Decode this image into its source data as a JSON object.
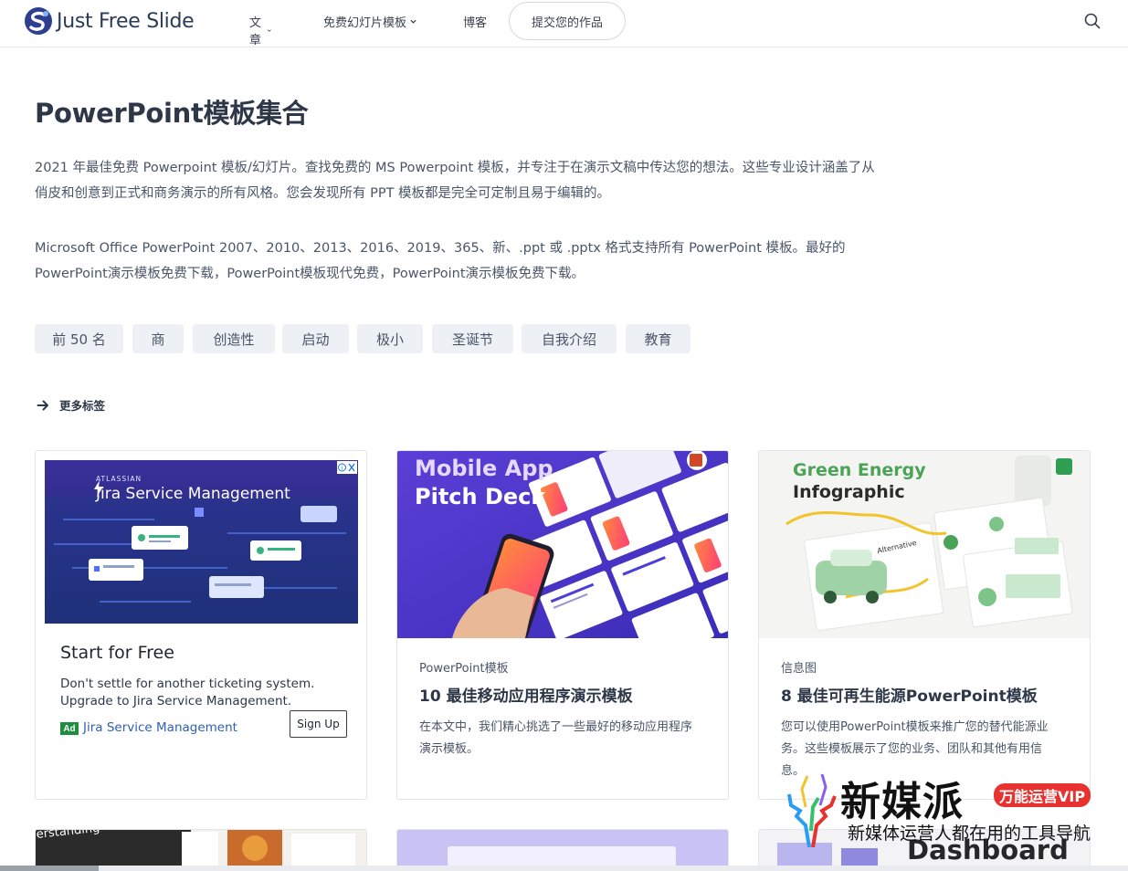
{
  "brand": {
    "logo_text": "Just Free Slide"
  },
  "nav": {
    "items": [
      {
        "label": "文章"
      },
      {
        "label": "免费幻灯片模板"
      },
      {
        "label": "博客"
      }
    ],
    "submit_label": "提交您的作品"
  },
  "page": {
    "title": "PowerPoint模板集合",
    "intro_1": "2021 年最佳免费 Powerpoint 模板/幻灯片。查找免费的 MS Powerpoint 模板，并专注于在演示文稿中传达您的想法。这些专业设计涵盖了从俏皮和创意到正式和商务演示的所有风格。您会发现所有 PPT 模板都是完全可定制且易于编辑的。",
    "intro_2": "Microsoft Office PowerPoint 2007、2010、2013、2016、2019、365、新、.ppt 或 .pptx 格式支持所有 PowerPoint 模板。最好的PowerPoint演示模板免费下载，PowerPoint模板现代免费，PowerPoint演示模板免费下载。"
  },
  "tags": [
    "前 50 名",
    "商",
    "创造性",
    "启动",
    "极小",
    "圣诞节",
    "自我介绍",
    "教育"
  ],
  "more_tags_label": "更多标签",
  "ad": {
    "brand": "ATLASSIAN",
    "product": "Jira Service Management",
    "headline": "Start for Free",
    "body": "Don't settle for another ticketing system. Upgrade to Jira Service Management.",
    "label": "Ad",
    "sponsor": "Jira Service Management",
    "cta": "Sign Up"
  },
  "cards": [
    {
      "thumb_line1": "Mobile App",
      "thumb_line2": "Pitch Deck",
      "category": "PowerPoint模板",
      "title": "10 最佳移动应用程序演示模板",
      "description": "在本文中，我们精心挑选了一些最好的移动应用程序演示模板。"
    },
    {
      "thumb_line1": "Green Energy",
      "thumb_line2": "Infographic",
      "category": "信息图",
      "title": "8 最佳可再生能源PowerPoint模板",
      "description": "您可以使用PowerPoint模板来推广您的替代能源业务。这些模板展示了您的业务、团队和其他有用信息。"
    }
  ],
  "row2_text": "erstanding",
  "watermark": {
    "name": "新媒派",
    "badge": "万能运营VIP",
    "subtitle": "新媒体运营人都在用的工具导航",
    "dashboard": "Dashboard"
  }
}
